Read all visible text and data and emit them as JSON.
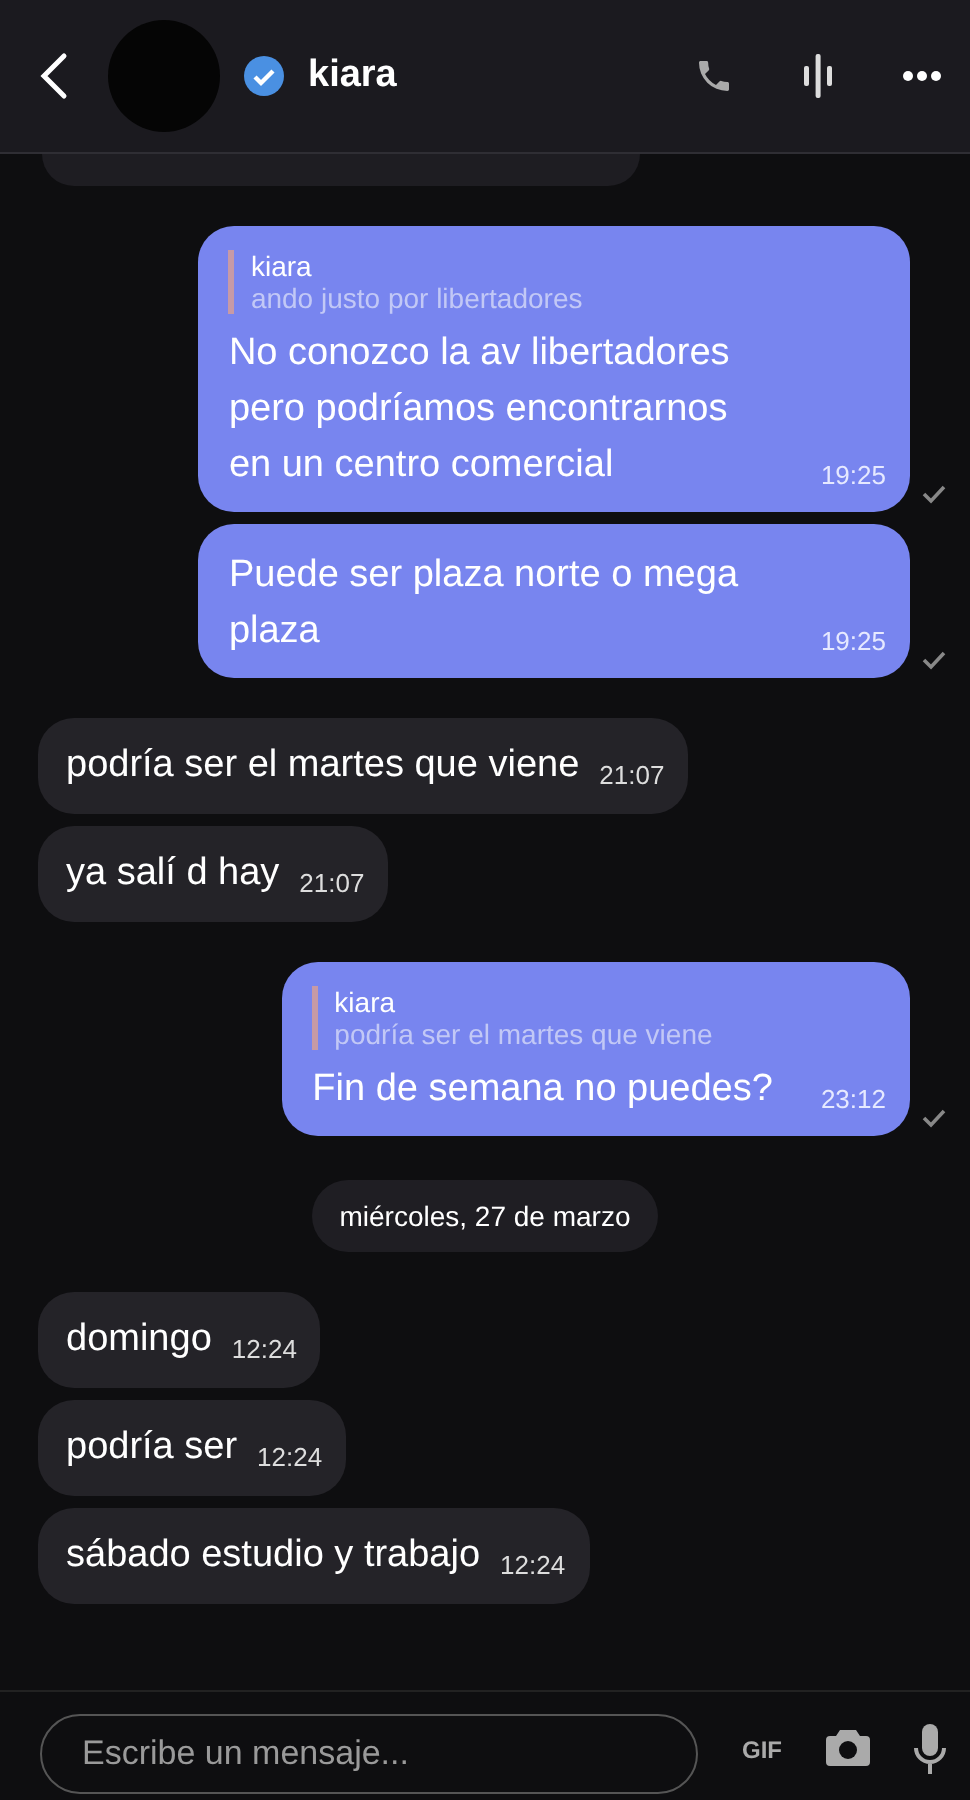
{
  "header": {
    "name": "kiara",
    "verified": true
  },
  "messages": [
    {
      "kind": "out",
      "reply": {
        "author": "kiara",
        "text": "ando justo por libertadores"
      },
      "text": "No conozco la av libertadores pero podríamos encontrarnos en un centro comercial",
      "time": "19:25"
    },
    {
      "kind": "out",
      "text": "Puede ser plaza norte o mega plaza",
      "time": "19:25"
    },
    {
      "kind": "in",
      "text": "podría ser el martes que viene",
      "time": "21:07"
    },
    {
      "kind": "in",
      "text": "ya salí d hay",
      "time": "21:07"
    },
    {
      "kind": "out",
      "reply": {
        "author": "kiara",
        "text": "podría ser el martes que viene"
      },
      "text": "Fin de semana no puedes?",
      "time": "23:12"
    },
    {
      "kind": "date",
      "text": "miércoles, 27 de marzo"
    },
    {
      "kind": "in",
      "text": "domingo",
      "time": "12:24"
    },
    {
      "kind": "in",
      "text": "podría ser",
      "time": "12:24"
    },
    {
      "kind": "in",
      "text": "sábado estudio y trabajo",
      "time": "12:24"
    }
  ],
  "composer": {
    "placeholder": "Escribe un mensaje...",
    "gif": "GIF"
  }
}
